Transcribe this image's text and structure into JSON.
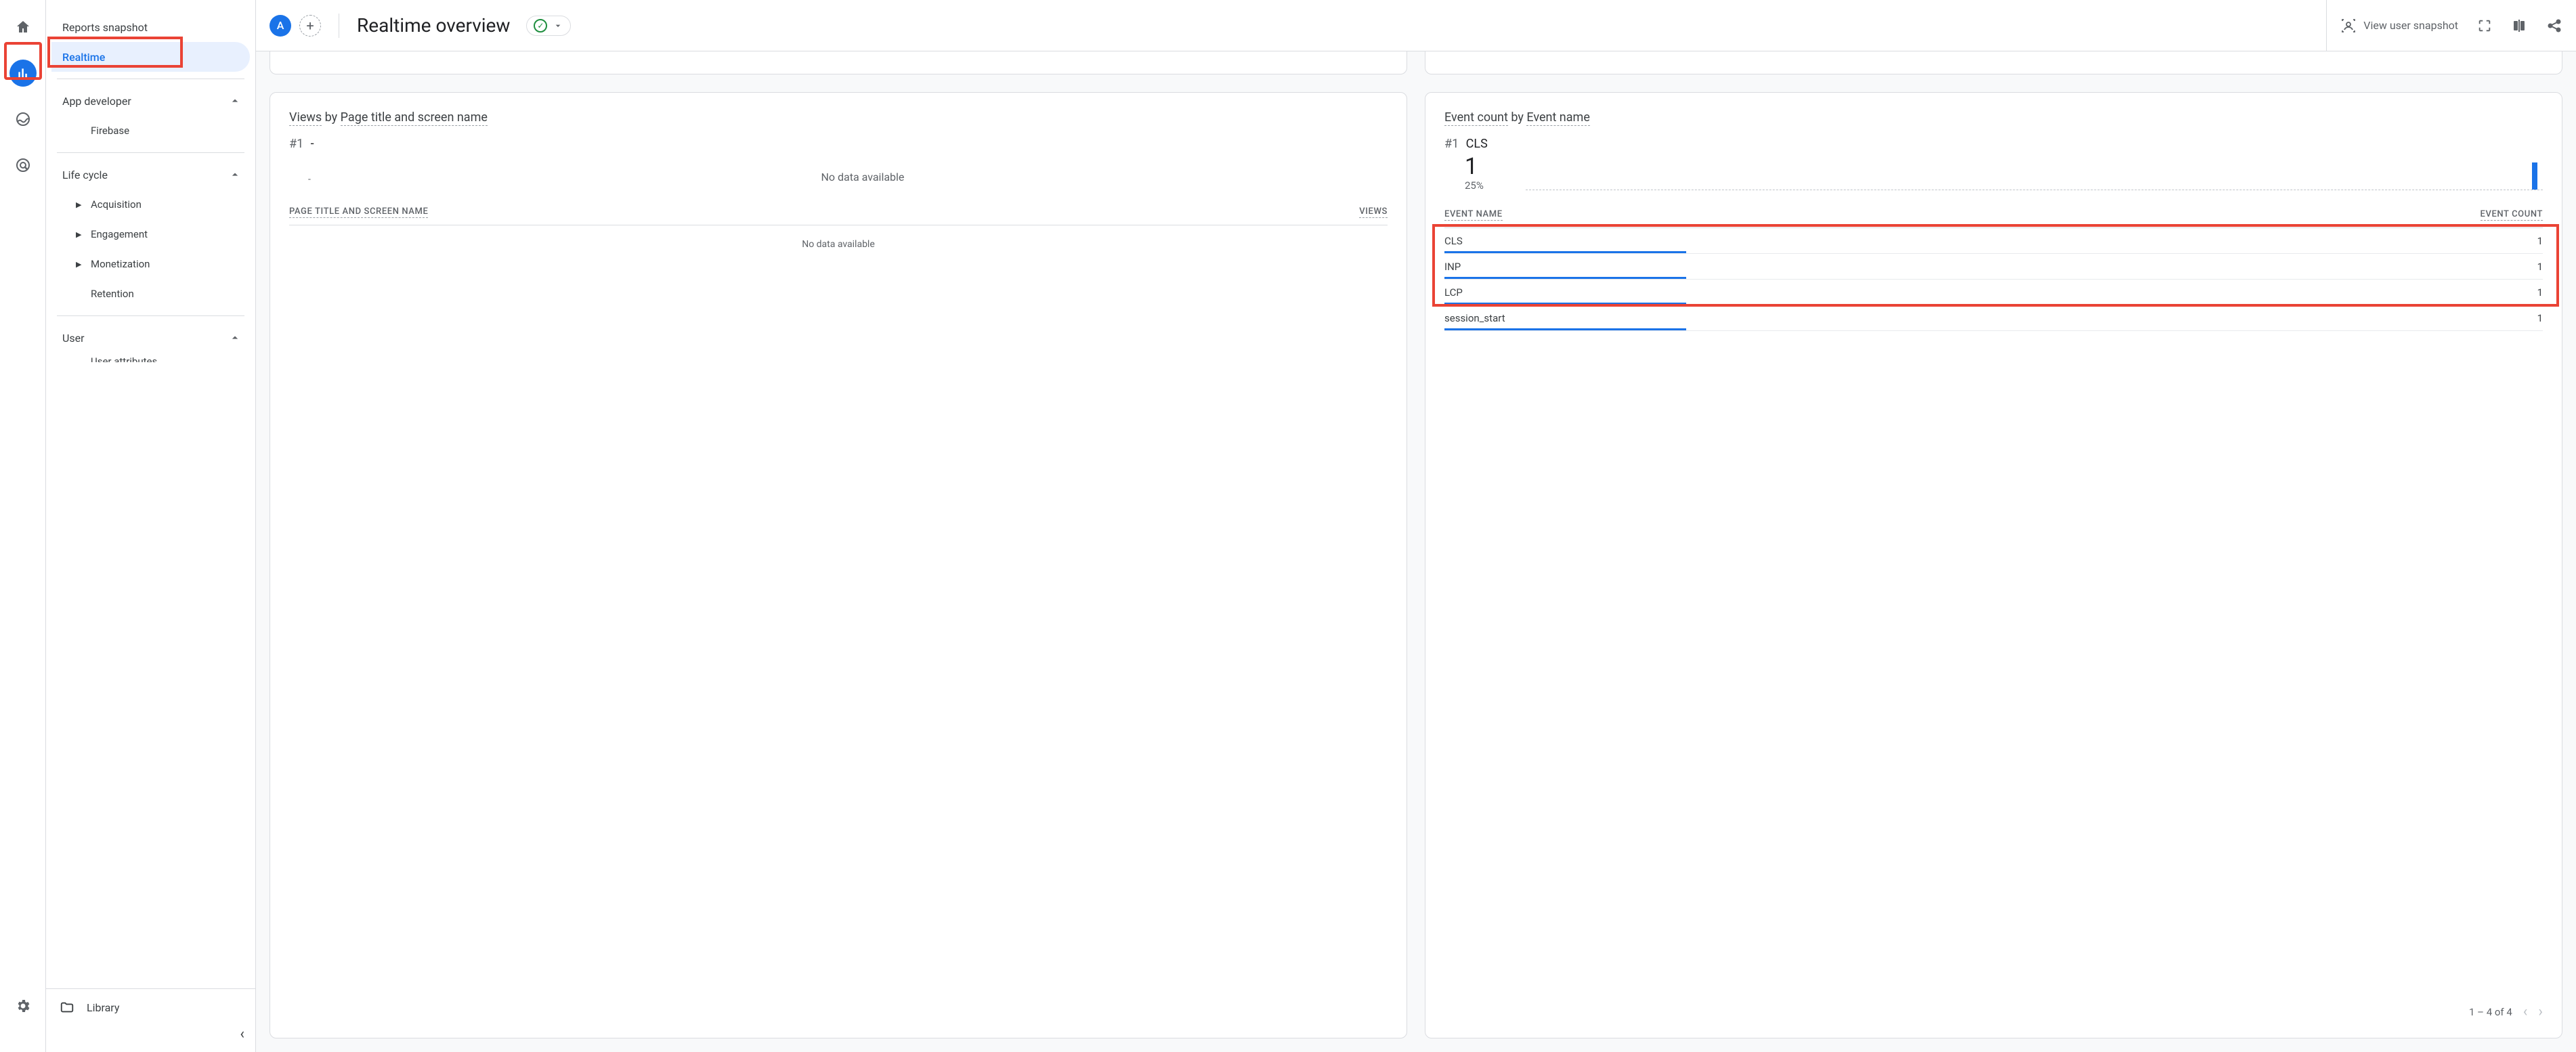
{
  "rail": {
    "user_chip": "A"
  },
  "sidebar": {
    "snapshot": "Reports snapshot",
    "realtime": "Realtime",
    "app_dev": "App developer",
    "firebase": "Firebase",
    "life_cycle": "Life cycle",
    "acquisition": "Acquisition",
    "engagement": "Engagement",
    "monetization": "Monetization",
    "retention": "Retention",
    "user": "User",
    "user_attributes_cut": "User attributes",
    "library": "Library"
  },
  "header": {
    "chip": "A",
    "title": "Realtime overview",
    "snapshot_link": "View user snapshot"
  },
  "card_views": {
    "title_a": "Views",
    "title_by": " by ",
    "title_b": "Page title and screen name",
    "rank": "#1",
    "rank_val": "-",
    "dash": "-",
    "nodata_top": "No data available",
    "col_a": "PAGE TITLE AND SCREEN NAME",
    "col_b": "VIEWS",
    "nodata": "No data available"
  },
  "card_events": {
    "title_a": "Event count",
    "title_by": " by ",
    "title_b": "Event name",
    "rank": "#1",
    "rank_val": "CLS",
    "big": "1",
    "pct": "25%",
    "col_a": "EVENT NAME",
    "col_b": "EVENT COUNT",
    "rows": [
      {
        "name": "CLS",
        "count": "1",
        "bar": 22
      },
      {
        "name": "INP",
        "count": "1",
        "bar": 22
      },
      {
        "name": "LCP",
        "count": "1",
        "bar": 22
      },
      {
        "name": "session_start",
        "count": "1",
        "bar": 22
      }
    ],
    "pager": "1 – 4 of 4"
  }
}
